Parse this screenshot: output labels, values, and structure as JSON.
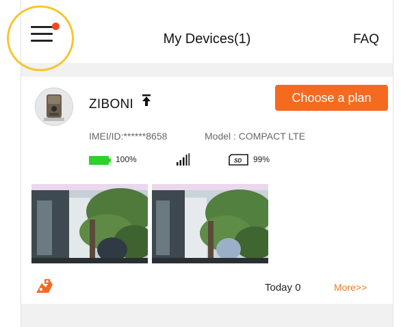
{
  "header": {
    "title": "My Devices(1)",
    "faq_label": "FAQ"
  },
  "device": {
    "name": "ZIBONI",
    "plan_button": "Choose a plan",
    "imei": "IMEI/ID:******8658",
    "model": "Model : COMPACT LTE",
    "battery": "100%",
    "battery_level": 1.0,
    "sd_usage": "99%"
  },
  "footer": {
    "today": "Today 0",
    "more": "More>>"
  },
  "colors": {
    "accent": "#f56a1e",
    "battery": "#2ed12e",
    "badge": "#ee4a22",
    "highlight": "#f7c52a"
  },
  "icons": [
    "menu-icon",
    "pin-to-top-icon",
    "battery-icon",
    "signal-icon",
    "sd-card-icon",
    "camera-logo-icon"
  ]
}
